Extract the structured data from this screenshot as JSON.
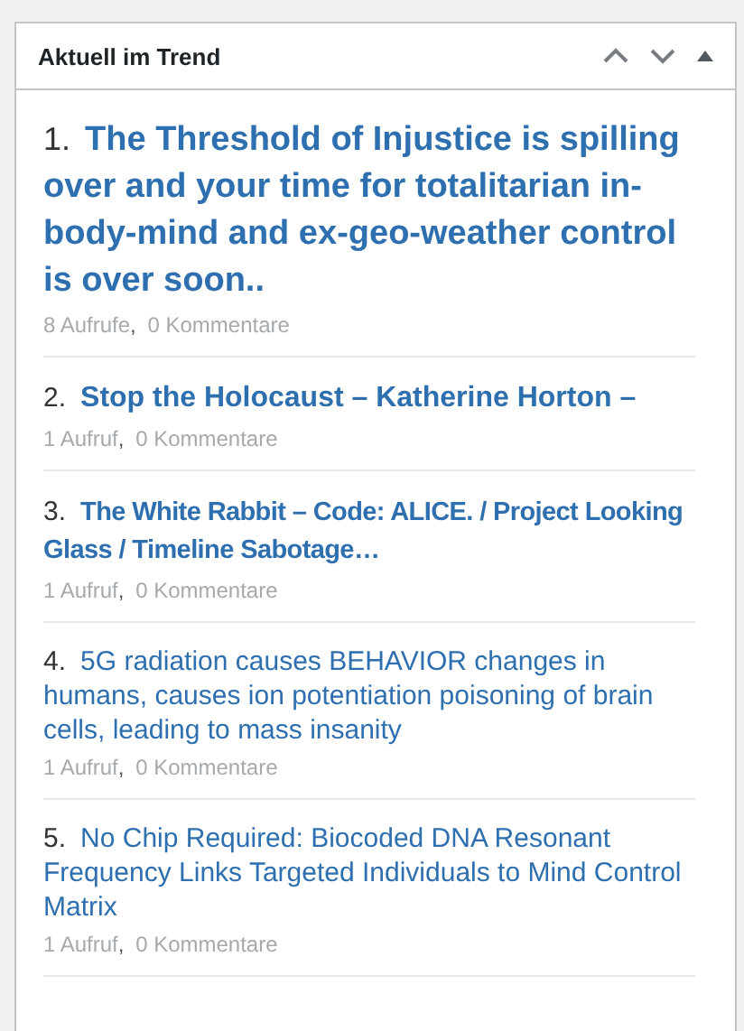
{
  "widget": {
    "title": "Aktuell im Trend"
  },
  "items": [
    {
      "number": "1.",
      "title": "The Threshold of Injustice is spilling over and your time for totalitarian in-body-mind and ex-geo-weather control is over soon..",
      "kind": "large",
      "views": "8 Aufrufe",
      "separator": ",",
      "comments": "0 Kommentare"
    },
    {
      "number": "2.",
      "title": "Stop the Holocaust – Katherine Horton –",
      "kind": "medium",
      "views": "1 Aufruf",
      "separator": ",",
      "comments": "0 Kommentare"
    },
    {
      "number": "3.",
      "title": "The White Rabbit – Code: ALICE. / Project Looking Glass / Timeline Sabotage…",
      "kind": "small",
      "views": "1 Aufruf",
      "separator": ",",
      "comments": "0 Kommentare"
    },
    {
      "number": "4.",
      "title": "5G radiation causes BEHAVIOR changes in humans, causes ion potentiation poisoning of brain cells, leading to mass insanity",
      "kind": "regular",
      "views": "1 Aufruf",
      "separator": ",",
      "comments": "0 Kommentare"
    },
    {
      "number": "5.",
      "title": "No Chip Required: Biocoded DNA Resonant Frequency Links Targeted Individuals to Mind Control Matrix",
      "kind": "regular",
      "views": "1 Aufruf",
      "separator": ",",
      "comments": "0 Kommentare"
    }
  ]
}
